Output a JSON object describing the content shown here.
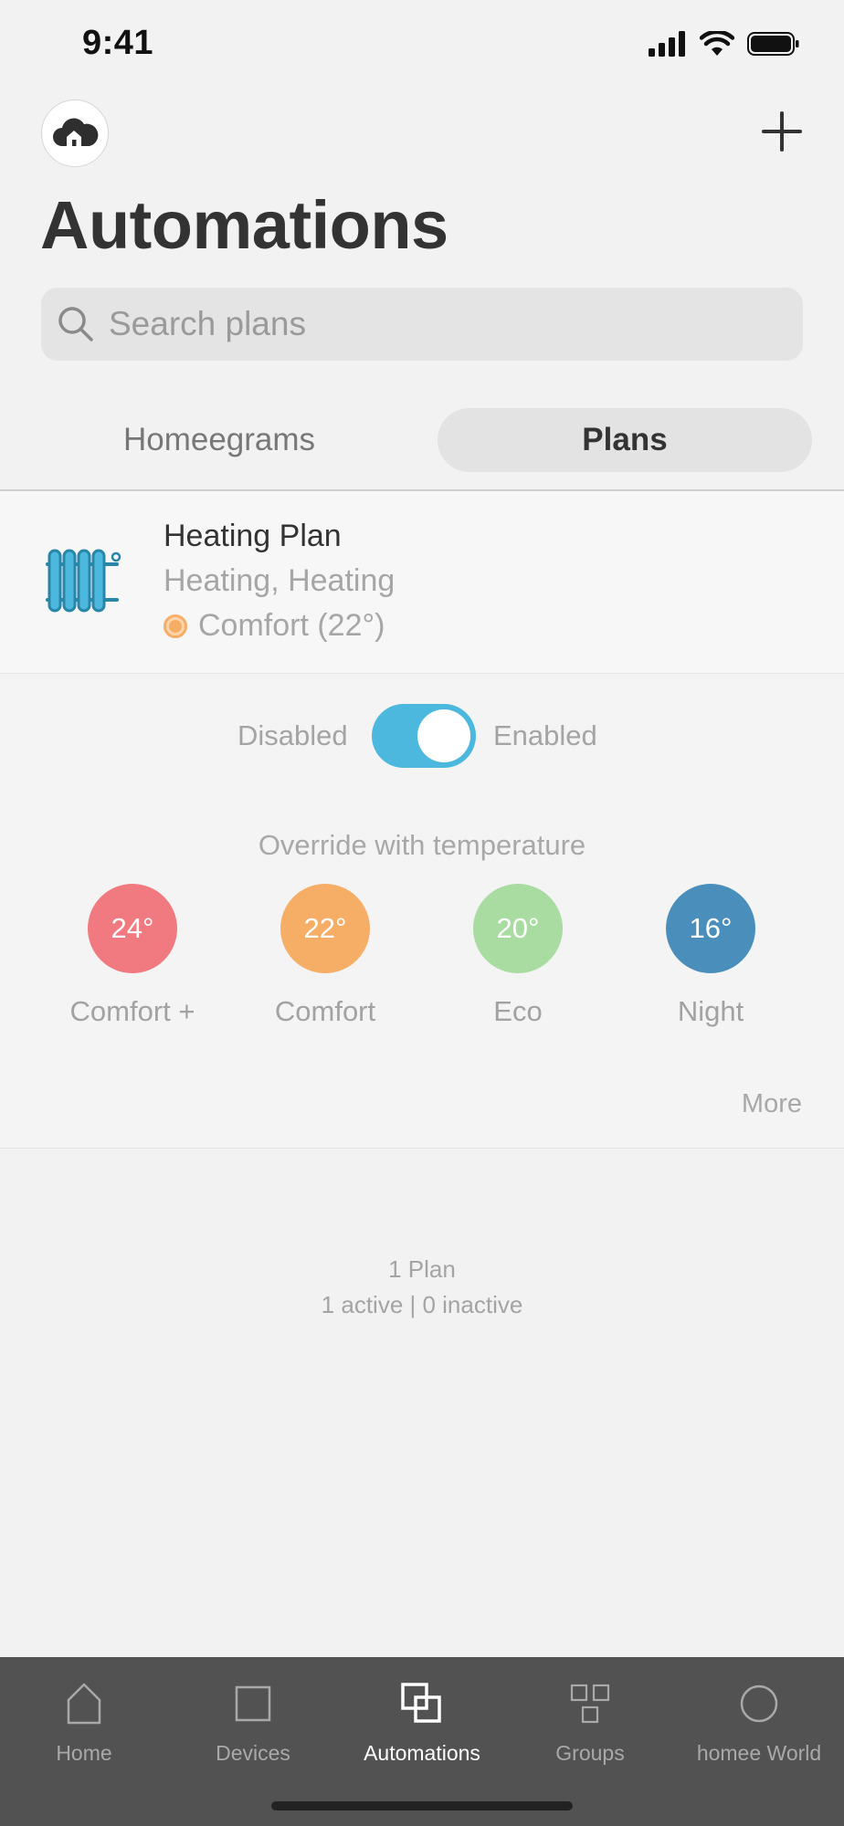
{
  "status_bar": {
    "time": "9:41",
    "icons": [
      "cellular-signal-icon",
      "wifi-icon",
      "battery-icon"
    ]
  },
  "header": {
    "left_icon": "cloud-home-icon",
    "right_icon": "plus-icon",
    "title": "Automations"
  },
  "search": {
    "placeholder": "Search plans",
    "value": ""
  },
  "tabs": {
    "items": [
      {
        "label": "Homeegrams",
        "selected": false
      },
      {
        "label": "Plans",
        "selected": true
      }
    ]
  },
  "plan": {
    "icon": "radiator-icon",
    "title": "Heating Plan",
    "subtitle": "Heating, Heating",
    "status": "Comfort (22°)",
    "status_color": "#f6ad66"
  },
  "controls": {
    "disabled_label": "Disabled",
    "enabled_label": "Enabled",
    "toggle_on": true,
    "toggle_color": "#4db8de",
    "override_label": "Override with temperature",
    "temperatures": [
      {
        "value": "24°",
        "name": "Comfort +",
        "color": "#f07a80"
      },
      {
        "value": "22°",
        "name": "Comfort",
        "color": "#f6ad66"
      },
      {
        "value": "20°",
        "name": "Eco",
        "color": "#a8dca0"
      },
      {
        "value": "16°",
        "name": "Night",
        "color": "#4a8fbb"
      }
    ],
    "more_label": "More"
  },
  "summary": {
    "count": "1 Plan",
    "detail": "1 active | 0 inactive"
  },
  "tabbar": {
    "items": [
      {
        "label": "Home",
        "icon": "home-icon",
        "active": false
      },
      {
        "label": "Devices",
        "icon": "devices-icon",
        "active": false
      },
      {
        "label": "Automations",
        "icon": "automations-icon",
        "active": true
      },
      {
        "label": "Groups",
        "icon": "groups-icon",
        "active": false
      },
      {
        "label": "homee World",
        "icon": "homee-world-icon",
        "active": false
      }
    ]
  }
}
